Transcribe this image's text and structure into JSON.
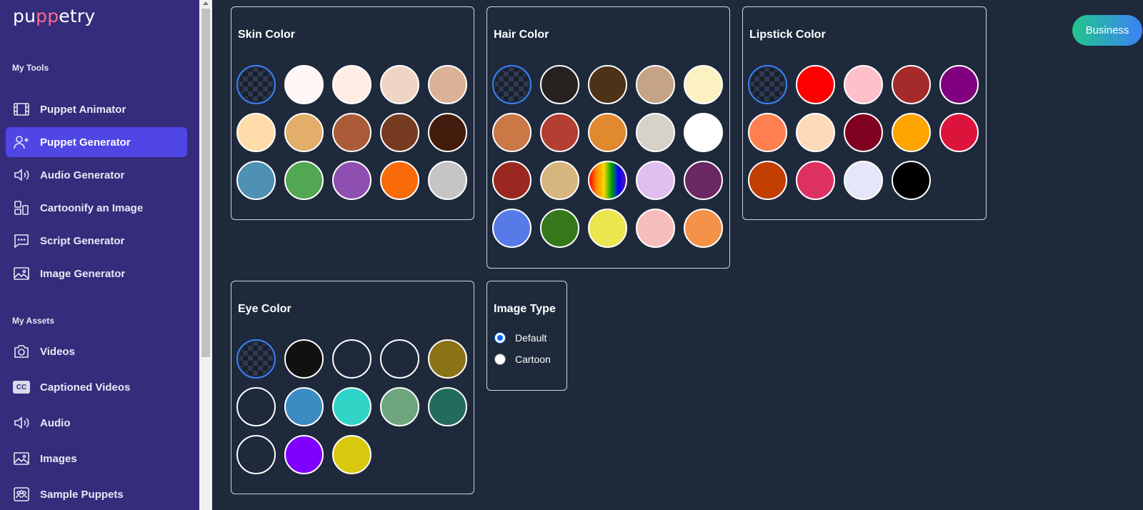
{
  "app": {
    "logo_prefix": "pu",
    "logo_pp": "pp",
    "logo_suffix": "etry"
  },
  "sidebar": {
    "tools_label": "My Tools",
    "tools": [
      {
        "label": "Puppet Animator",
        "icon": "film-icon",
        "active": false
      },
      {
        "label": "Puppet Generator",
        "icon": "user-plus-icon",
        "active": true
      },
      {
        "label": "Audio Generator",
        "icon": "speaker-icon",
        "active": false
      },
      {
        "label": "Cartoonify an Image",
        "icon": "layout-icon",
        "active": false
      },
      {
        "label": "Script Generator",
        "icon": "chat-icon",
        "active": false
      },
      {
        "label": "Image Generator",
        "icon": "image-icon",
        "active": false
      }
    ],
    "assets_label": "My Assets",
    "assets": [
      {
        "label": "Videos",
        "icon": "camera-icon"
      },
      {
        "label": "Captioned Videos",
        "icon": "cc-icon",
        "badge": "CC"
      },
      {
        "label": "Audio",
        "icon": "speaker-icon"
      },
      {
        "label": "Images",
        "icon": "image-icon"
      },
      {
        "label": "Sample Puppets",
        "icon": "group-icon"
      }
    ]
  },
  "panels": {
    "skin": {
      "title": "Skin Color",
      "swatches": [
        "none",
        "#fff6f5",
        "#ffede4",
        "#f0d5c5",
        "#dbb296",
        "#ffdcaa",
        "#e2ae6a",
        "#ab5b38",
        "#773b21",
        "#421b0c",
        "#4e91b2",
        "#52a752",
        "#8e4fb0",
        "#f96a08",
        "#c5c5c5"
      ]
    },
    "hair": {
      "title": "Hair Color",
      "swatches": [
        "none",
        "#252220",
        "#4e3217",
        "#c4a485",
        "#fcf1c1",
        "#c97846",
        "#b33e31",
        "#e0892f",
        "#d4d2c9",
        "#ffffff",
        "#9a2820",
        "#d7b57f",
        "rainbow",
        "#dfc0ec",
        "#6a2962",
        "#567ae8",
        "#36771c",
        "#ebe54e",
        "#f6bfbe",
        "#f49249"
      ]
    },
    "lipstick": {
      "title": "Lipstick Color",
      "swatches": [
        "none",
        "#ff0000",
        "#ffc0cb",
        "#a52a2a",
        "#800080",
        "#ff7f50",
        "#ffdab9",
        "#800020",
        "#ffa500",
        "#dc143c",
        "#c23d00",
        "#de3163",
        "#e6e6fa",
        "#000000"
      ]
    },
    "eye": {
      "title": "Eye Color",
      "swatches": [
        "none",
        "#111111",
        "#1e293b",
        "#1e293b",
        "#8b7317",
        "#1e293b",
        "#3a8cc3",
        "#30d5c8",
        "#6fa57e",
        "#236b5e",
        "#1e293b",
        "#8000ff",
        "#d8c90f"
      ]
    },
    "image_type": {
      "title": "Image Type",
      "options": [
        {
          "label": "Default",
          "checked": true
        },
        {
          "label": "Cartoon",
          "checked": false
        }
      ]
    }
  },
  "header": {
    "business_label": "Business"
  },
  "colors": {
    "sidebar_bg": "#352c7b",
    "active_nav": "#4f46e5",
    "content_bg": "#1e293b",
    "selected_ring": "#3b82f6"
  }
}
